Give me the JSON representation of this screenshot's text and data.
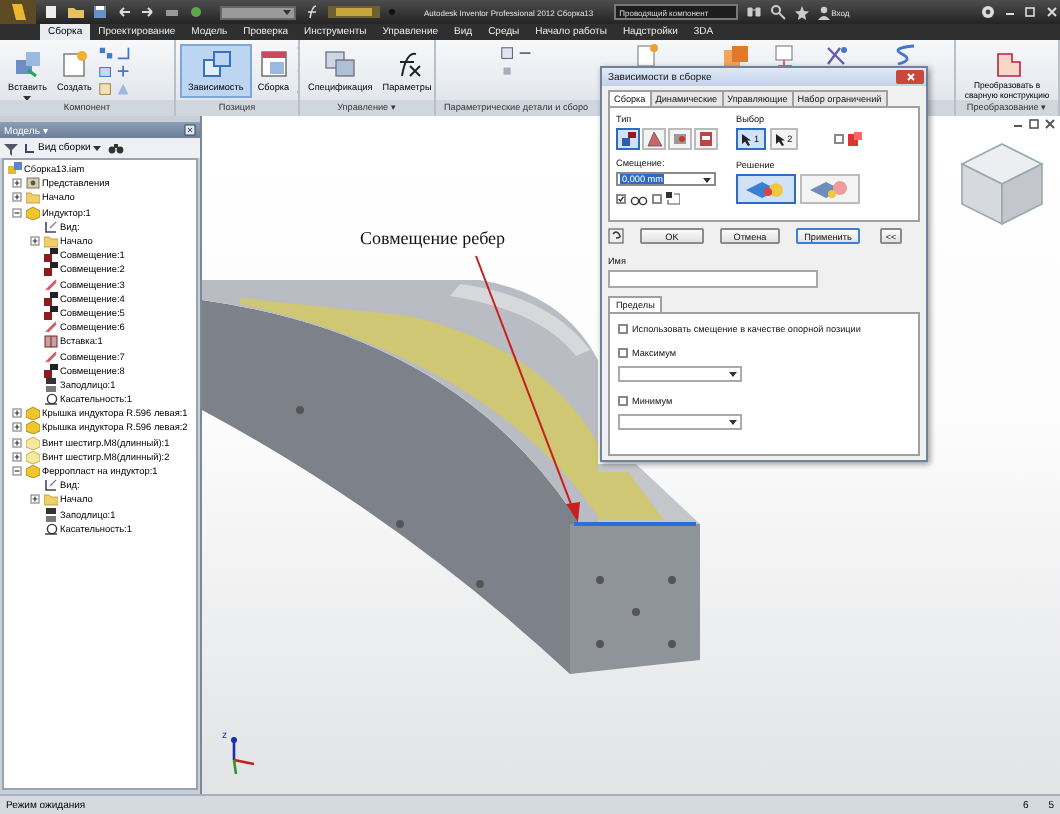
{
  "window": {
    "title": "Autodesk Inventor Professional 2012 Сборка13",
    "search_text": "Проводящий компонент",
    "sign_in": "Вход"
  },
  "ribbon": {
    "tabs": [
      {
        "label": "Сборка",
        "selected": true
      },
      {
        "label": "Проектирование",
        "selected": false
      },
      {
        "label": "Модель",
        "selected": false
      },
      {
        "label": "Проверка",
        "selected": false
      },
      {
        "label": "Инструменты",
        "selected": false
      },
      {
        "label": "Управление",
        "selected": false
      },
      {
        "label": "Вид",
        "selected": false
      },
      {
        "label": "Среды",
        "selected": false
      },
      {
        "label": "Начало работы",
        "selected": false
      },
      {
        "label": "Надстройки",
        "selected": false
      },
      {
        "label": "3DA",
        "selected": false
      }
    ],
    "panels": [
      {
        "title": "Компонент",
        "buttons": [
          {
            "label": "Вставить",
            "selected": false,
            "dropdown": true
          },
          {
            "label": "Создать",
            "selected": false
          }
        ]
      },
      {
        "title": "Позиция",
        "buttons": [
          {
            "label": "Зависимость",
            "selected": true
          },
          {
            "label": "Сборка",
            "selected": false
          }
        ]
      },
      {
        "title": "Управление ▾",
        "buttons": [
          {
            "label": "Спецификация",
            "selected": false
          },
          {
            "label": "Параметры",
            "selected": false
          }
        ]
      },
      {
        "title": "Параметрические детали и сборо"
      },
      {
        "title": "Преобразование ▾",
        "buttons": [
          {
            "label": "Преобразовать в сварную конструкцию",
            "selected": false
          }
        ]
      }
    ]
  },
  "browser": {
    "title": "Модель ▾",
    "view": "Вид сборки",
    "tree": [
      {
        "label": "Сборка13.iam",
        "kind": "assembly",
        "children": [
          {
            "label": "Представления",
            "kind": "representations",
            "expanded": false
          },
          {
            "label": "Начало",
            "kind": "folder",
            "expanded": false
          },
          {
            "label": "Индуктор:1",
            "kind": "part",
            "expanded": true,
            "children": [
              {
                "label": "Вид:",
                "kind": "view"
              },
              {
                "label": "Начало",
                "kind": "folder",
                "expanded": false
              },
              {
                "label": "Совмещение:1",
                "kind": "mate"
              },
              {
                "label": "Совмещение:2",
                "kind": "mate"
              },
              {
                "label": "Совмещение:3",
                "kind": "mate-alt"
              },
              {
                "label": "Совмещение:4",
                "kind": "mate"
              },
              {
                "label": "Совмещение:5",
                "kind": "mate"
              },
              {
                "label": "Совмещение:6",
                "kind": "mate-alt"
              },
              {
                "label": "Вставка:1",
                "kind": "insert"
              },
              {
                "label": "Совмещение:7",
                "kind": "mate-alt"
              },
              {
                "label": "Совмещение:8",
                "kind": "mate"
              },
              {
                "label": "Заподлицо:1",
                "kind": "flush"
              },
              {
                "label": "Касательность:1",
                "kind": "tangent"
              }
            ]
          },
          {
            "label": "Крышка индуктора R.596 левая:1",
            "kind": "part",
            "expanded": false
          },
          {
            "label": "Крышка индуктора R.596 левая:2",
            "kind": "part",
            "expanded": false
          },
          {
            "label": "Винт шестигр.M8(длинный):1",
            "kind": "part-alt",
            "expanded": false
          },
          {
            "label": "Винт шестигр.M8(длинный):2",
            "kind": "part-alt",
            "expanded": false
          },
          {
            "label": "Ферропласт на индуктор:1",
            "kind": "part",
            "expanded": true,
            "children": [
              {
                "label": "Вид:",
                "kind": "view"
              },
              {
                "label": "Начало",
                "kind": "folder",
                "expanded": false
              },
              {
                "label": "Заподлицо:1",
                "kind": "flush"
              },
              {
                "label": "Касательность:1",
                "kind": "tangent"
              }
            ]
          }
        ]
      }
    ]
  },
  "view": {
    "annotation": "Совмещение ребер",
    "axis_label": "z"
  },
  "dialog": {
    "title": "Зависимости в сборке",
    "tabs": [
      {
        "label": "Сборка",
        "selected": true
      },
      {
        "label": "Динамические",
        "selected": false
      },
      {
        "label": "Управляющие",
        "selected": false
      },
      {
        "label": "Набор ограничений",
        "selected": false
      }
    ],
    "type_label": "Тип",
    "types": [
      {
        "selected": true
      },
      {
        "selected": false
      },
      {
        "selected": false
      },
      {
        "selected": false
      }
    ],
    "selection_label": "Выбор",
    "selections": [
      {
        "label": "1",
        "selected": true
      },
      {
        "label": "2",
        "selected": false
      }
    ],
    "pick_checkbox": {
      "checked": false
    },
    "offset": {
      "label": "Смещение:",
      "value": "0,000 mm",
      "highlighted": true
    },
    "solution_label": "Решение",
    "solutions": [
      {
        "selected": true
      },
      {
        "selected": false
      }
    ],
    "show_preview": {
      "checked": true
    },
    "predict_offset": {
      "checked": false
    },
    "buttons": [
      "OK",
      "Отмена",
      "Применить",
      "<<"
    ],
    "name_label": "Имя",
    "limits": {
      "tab": "Пределы",
      "use_offset": {
        "label": "Использовать смещение в качестве опорной позиции",
        "checked": false
      },
      "maximum": {
        "label": "Максимум",
        "checked": false
      },
      "minimum": {
        "label": "Минимум",
        "checked": false
      }
    }
  },
  "status_bar": {
    "text": "Режим ожидания",
    "counts": [
      "6",
      "5"
    ]
  }
}
